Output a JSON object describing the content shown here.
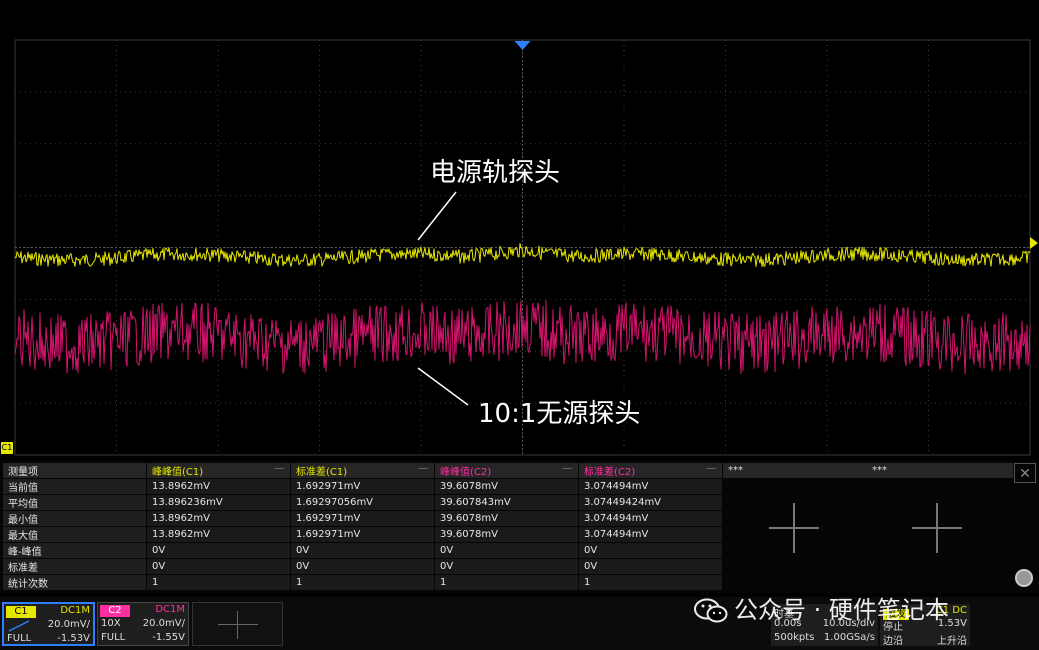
{
  "annotations": {
    "rail_probe": "电源轨探头",
    "passive_probe": "10:1无源探头"
  },
  "channel_marker": "C1",
  "colors": {
    "ch1": "#e6e600",
    "ch2": "#d4146e",
    "grid": "#3a3a3a",
    "trigger_marker": "#2f7fff"
  },
  "measurements": {
    "headers": [
      "测量项",
      "峰峰值(C1)",
      "标准差(C1)",
      "峰峰值(C2)",
      "标准差(C2)"
    ],
    "extra_headers": [
      "***",
      "***"
    ],
    "rows": [
      [
        "当前值",
        "13.8962mV",
        "1.692971mV",
        "39.6078mV",
        "3.074494mV"
      ],
      [
        "平均值",
        "13.896236mV",
        "1.69297056mV",
        "39.607843mV",
        "3.07449424mV"
      ],
      [
        "最小值",
        "13.8962mV",
        "1.692971mV",
        "39.6078mV",
        "3.074494mV"
      ],
      [
        "最大值",
        "13.8962mV",
        "1.692971mV",
        "39.6078mV",
        "3.074494mV"
      ],
      [
        "峰-峰值",
        "0V",
        "0V",
        "0V",
        "0V"
      ],
      [
        "标准差",
        "0V",
        "0V",
        "0V",
        "0V"
      ],
      [
        "统计次数",
        "1",
        "1",
        "1",
        "1"
      ]
    ]
  },
  "channels": {
    "c1": {
      "name": "C1",
      "coupling": "DC1M",
      "scale": "20.0mV/",
      "bw": "FULL",
      "offset": "-1.53V"
    },
    "c2": {
      "name": "C2",
      "coupling": "DC1M",
      "probe": "10X",
      "scale": "20.0mV/",
      "bw": "FULL",
      "offset": "-1.55V"
    }
  },
  "timebase": {
    "label": "时基",
    "delay": "0.00s",
    "scale": "10.0us/div",
    "memory": "500kpts",
    "rate": "1.00GSa/s"
  },
  "trigger": {
    "label": "触发",
    "source": "C1 DC",
    "state": "停止",
    "level": "1.53V",
    "type": "边沿",
    "slope": "上升沿"
  },
  "watermark": "公众号 · 硬件笔记本",
  "icons": {
    "close": "close-icon",
    "scroll": "scroll-knob-icon",
    "wechat": "wechat-icon"
  },
  "close_glyph": "✕"
}
